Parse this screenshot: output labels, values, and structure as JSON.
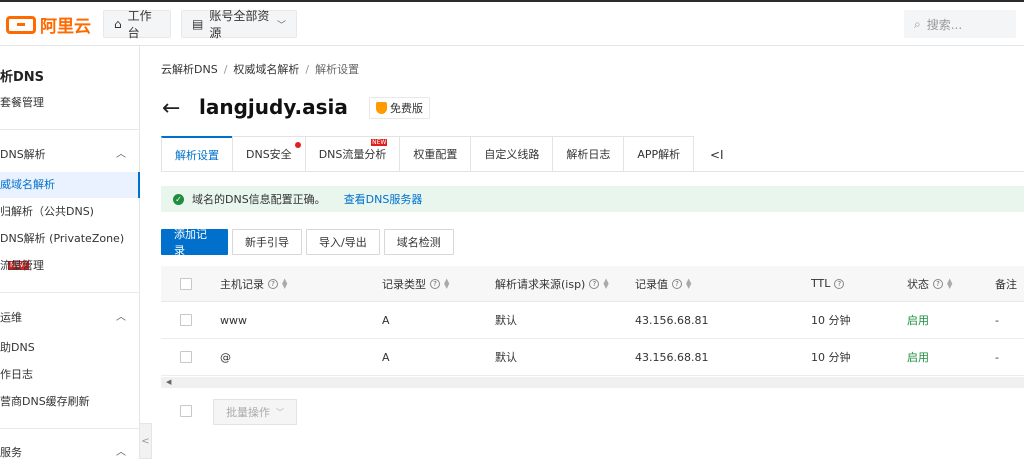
{
  "topbar": {
    "logo_text": "阿里云",
    "home_label": "工作台",
    "resources_label": "账号全部资源",
    "search_placeholder": "搜索..."
  },
  "sidebar": {
    "title": "析DNS",
    "items": [
      {
        "label": "套餐管理"
      },
      {
        "label": "DNS解析"
      },
      {
        "label": "威域名解析"
      },
      {
        "label": "归解析（公共DNS)"
      },
      {
        "label": "DNS解析 (PrivateZone)",
        "tag": "NEW"
      },
      {
        "label": "流量管理"
      },
      {
        "label": "运维"
      },
      {
        "label": "助DNS"
      },
      {
        "label": "作日志"
      },
      {
        "label": "营商DNS缓存刷新"
      },
      {
        "label": "服务"
      }
    ],
    "collapse_glyph": "<"
  },
  "breadcrumb": [
    "云解析DNS",
    "权威域名解析",
    "解析设置"
  ],
  "breadcrumb_sep": "/",
  "domain": "langjudy.asia",
  "plan_badge": "免费版",
  "tabs": [
    {
      "label": "解析设置"
    },
    {
      "label": "DNS安全"
    },
    {
      "label": "DNS流量分析",
      "tag": "NEW"
    },
    {
      "label": "权重配置"
    },
    {
      "label": "自定义线路"
    },
    {
      "label": "解析日志"
    },
    {
      "label": "APP解析"
    }
  ],
  "tabs_more": "<I",
  "alert": {
    "message": "域名的DNS信息配置正确。",
    "link": "查看DNS服务器"
  },
  "toolbar": {
    "add": "添加记录",
    "guide": "新手引导",
    "import_export": "导入/导出",
    "check": "域名检测"
  },
  "table": {
    "headers": [
      "主机记录",
      "记录类型",
      "解析请求来源(isp)",
      "记录值",
      "TTL",
      "状态",
      "备注"
    ],
    "rows": [
      {
        "host": "www",
        "type": "A",
        "isp": "默认",
        "value": "43.156.68.81",
        "ttl": "10 分钟",
        "status": "启用",
        "note": "-"
      },
      {
        "host": "@",
        "type": "A",
        "isp": "默认",
        "value": "43.156.68.81",
        "ttl": "10 分钟",
        "status": "启用",
        "note": "-"
      }
    ]
  },
  "batch_label": "批量操作",
  "colors": {
    "accent": "#0070cc",
    "brand": "#ff6a00",
    "success": "#1e8e3e",
    "new_tag": "#e02020"
  }
}
